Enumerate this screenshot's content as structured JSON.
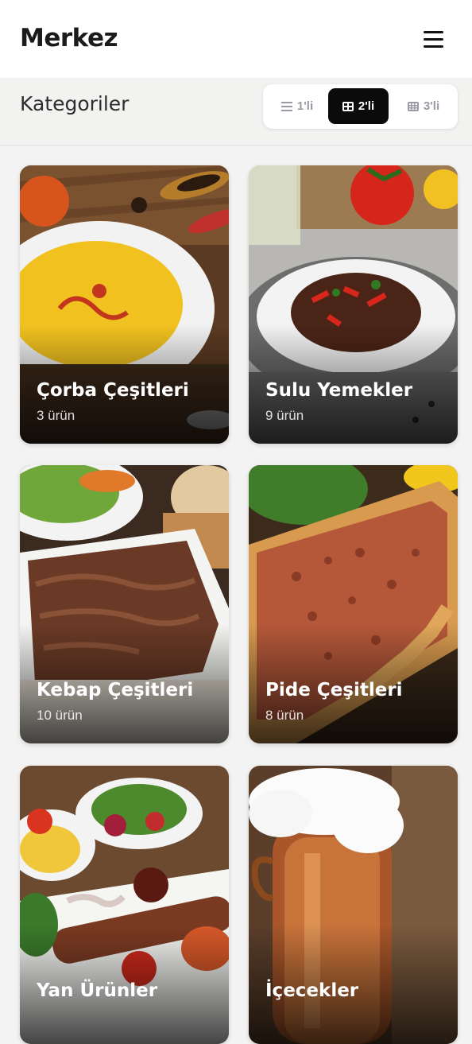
{
  "header": {
    "title": "Merkez",
    "menu_icon": "hamburger-icon"
  },
  "subheader": {
    "title": "Kategoriler",
    "view_options": [
      {
        "label": "1'li",
        "icon": "list-icon",
        "active": false
      },
      {
        "label": "2'li",
        "icon": "grid-2-icon",
        "active": true
      },
      {
        "label": "3'li",
        "icon": "grid-3-icon",
        "active": false
      }
    ]
  },
  "categories": [
    {
      "name": "Çorba Çeşitleri",
      "count": "3 ürün",
      "image": "soup-photo"
    },
    {
      "name": "Sulu Yemekler",
      "count": "9 ürün",
      "image": "stew-photo"
    },
    {
      "name": "Kebap Çeşitleri",
      "count": "10 ürün",
      "image": "doner-photo"
    },
    {
      "name": "Pide Çeşitleri",
      "count": "8 ürün",
      "image": "pide-photo"
    },
    {
      "name": "Yan Ürünler",
      "count": "",
      "image": "kebab-plate-photo"
    },
    {
      "name": "İçecekler",
      "count": "",
      "image": "ayran-photo"
    }
  ],
  "colors": {
    "accent": "#0b0b0b",
    "background": "#f3f3f3"
  }
}
